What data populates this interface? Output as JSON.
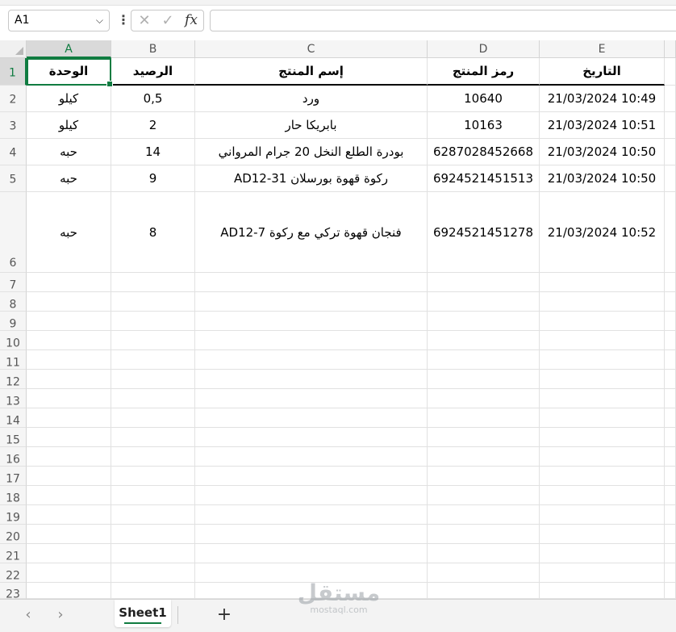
{
  "formula_bar": {
    "name_box": "A1",
    "name_box_dropdown": "⌵",
    "more": "⋮",
    "cancel": "✕",
    "enter": "✓",
    "fx": "fx",
    "formula": ""
  },
  "columns": [
    "A",
    "B",
    "C",
    "D",
    "E"
  ],
  "rows": [
    "1",
    "2",
    "3",
    "4",
    "5",
    "6",
    "7",
    "8",
    "9",
    "10",
    "11",
    "12",
    "13",
    "14",
    "15",
    "16",
    "17",
    "18",
    "19",
    "20",
    "21",
    "22",
    "23"
  ],
  "table": {
    "headers": {
      "A": "الوحدة",
      "B": "الرصيد",
      "C": "إسم المنتج",
      "D": "رمز المنتج",
      "E": "التاريخ"
    },
    "records": [
      {
        "A": "كيلو",
        "B": "0,5",
        "C": "ورد",
        "D": "10640",
        "E": "21/03/2024 10:49"
      },
      {
        "A": "كيلو",
        "B": "2",
        "C": "بابريكا حار",
        "D": "10163",
        "E": "21/03/2024 10:51"
      },
      {
        "A": "حبه",
        "B": "14",
        "C": "بودرة الطلع النخل 20 جرام المرواني",
        "D": "6287028452668",
        "E": "21/03/2024 10:50"
      },
      {
        "A": "حبه",
        "B": "9",
        "C": "ركوة قهوة بورسلان  AD12-31",
        "D": "6924521451513",
        "E": "21/03/2024 10:50"
      },
      {
        "A": "حبه",
        "B": "8",
        "C": "فنجان قهوة تركي مع ركوة  AD12-7",
        "D": "6924521451278",
        "E": "21/03/2024 10:52"
      }
    ]
  },
  "sheets": {
    "prev": "‹",
    "next": "›",
    "active": "Sheet1",
    "add": "+"
  },
  "watermark": {
    "arabic": "مستقل",
    "latin": "mostaql.com"
  },
  "colors": {
    "accent": "#107c41",
    "header_bg": "#f5f5f5",
    "selected_header_bg": "#d9d9d9",
    "gridline": "#e1e1e1"
  }
}
